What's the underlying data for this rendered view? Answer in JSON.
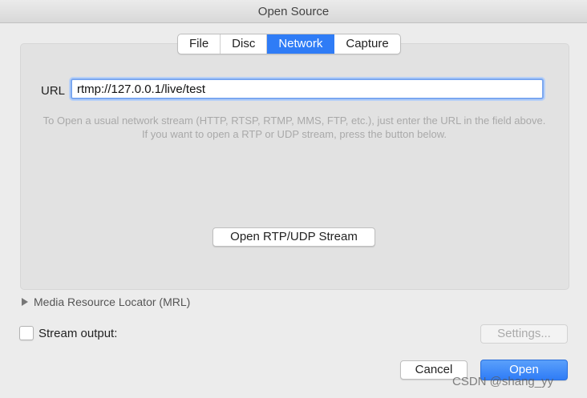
{
  "window": {
    "title": "Open Source"
  },
  "tabs": [
    {
      "label": "File"
    },
    {
      "label": "Disc"
    },
    {
      "label": "Network",
      "active": true
    },
    {
      "label": "Capture"
    }
  ],
  "network": {
    "url_label": "URL",
    "url_value": "rtmp://127.0.0.1/live/test",
    "help_text": "To Open a usual network stream (HTTP, RTSP, RTMP, MMS, FTP, etc.), just enter the URL in the field above. If you want to open a RTP or UDP stream, press the button below.",
    "rtp_button": "Open RTP/UDP Stream"
  },
  "mrl": {
    "label": "Media Resource Locator (MRL)"
  },
  "stream_output": {
    "label": "Stream output:",
    "checked": false,
    "settings_button": "Settings..."
  },
  "footer": {
    "cancel": "Cancel",
    "open": "Open"
  },
  "watermark": "CSDN @shang_yy",
  "colors": {
    "accent": "#2f7cf6",
    "background": "#ececec"
  }
}
